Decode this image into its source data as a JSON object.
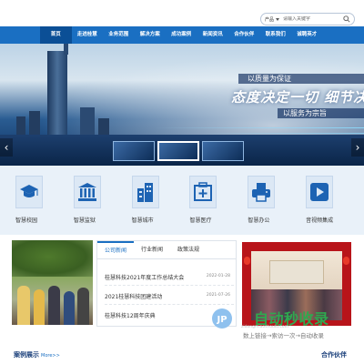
{
  "search": {
    "category": "产品",
    "placeholder": "请输入关键字"
  },
  "nav": {
    "items": [
      {
        "label": "首页",
        "active": true
      },
      {
        "label": "走进桂慧",
        "active": false
      },
      {
        "label": "业务范围",
        "active": false
      },
      {
        "label": "解决方案",
        "active": false
      },
      {
        "label": "成功案例",
        "active": false
      },
      {
        "label": "新闻资讯",
        "active": false
      },
      {
        "label": "合作伙伴",
        "active": false
      },
      {
        "label": "联系我们",
        "active": false
      },
      {
        "label": "诚聘英才",
        "active": false
      }
    ]
  },
  "banner": {
    "slogan_line1": "以质量为保证",
    "slogan_line2": "态度决定一切  细节决",
    "slogan_line3": "以服务为宗旨",
    "prev_glyph": "‹",
    "next_glyph": "›"
  },
  "services": [
    {
      "label": "智慧校园",
      "icon": "graduation-cap-icon"
    },
    {
      "label": "智慧监狱",
      "icon": "prison-building-icon"
    },
    {
      "label": "智慧城市",
      "icon": "city-buildings-icon"
    },
    {
      "label": "智慧医疗",
      "icon": "medical-box-icon"
    },
    {
      "label": "智慧办公",
      "icon": "printer-icon"
    },
    {
      "label": "音视频集成",
      "icon": "play-video-icon"
    }
  ],
  "news": {
    "tabs": [
      {
        "label": "公司新闻",
        "active": true
      },
      {
        "label": "行业新闻",
        "active": false
      },
      {
        "label": "政策法规",
        "active": false
      }
    ],
    "items": [
      {
        "title": "桂慧科技2021年度工作总结大会",
        "date": "2022-01-28"
      },
      {
        "title": "2021桂慧科技团建活动",
        "date": "2021-07-26"
      },
      {
        "title": "桂慧科技12周年庆典",
        "date": ""
      }
    ]
  },
  "watermark": {
    "title": "自动秒收录",
    "url": "zidongmiaoshoulu.com",
    "subtitle": "数上链接→索访一次→自动收录"
  },
  "footer": {
    "cases_label": "案例展示",
    "more_label": "More>>",
    "partners_label": "合作伙伴"
  },
  "colors": {
    "nav_bg": "#1a6fc2",
    "nav_active": "#0b4f96",
    "service_icon": "#1d63b3",
    "watermark_green": "#2fa84f"
  }
}
